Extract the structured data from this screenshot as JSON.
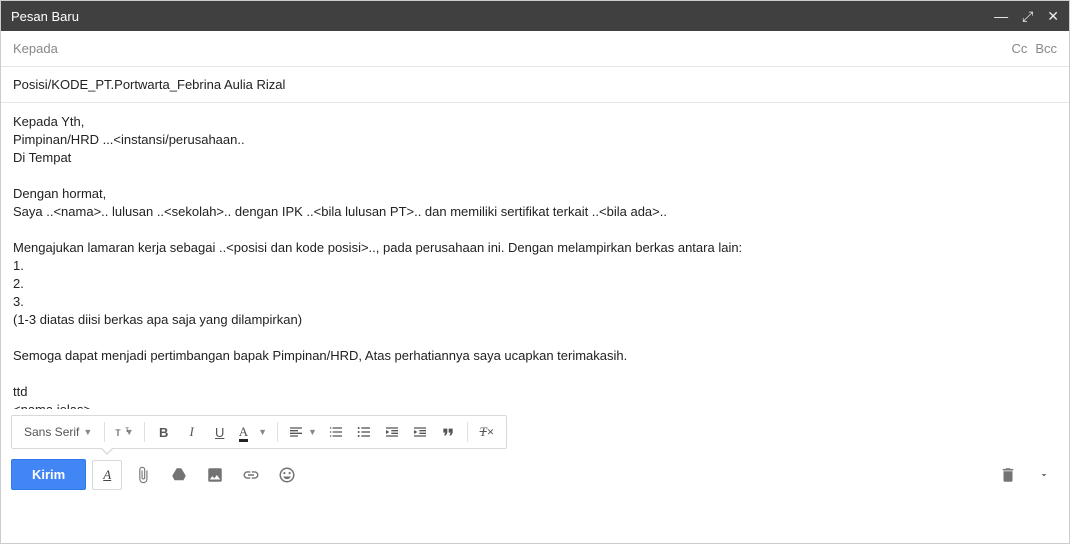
{
  "window": {
    "title": "Pesan Baru"
  },
  "to": {
    "placeholder": "Kepada",
    "cc": "Cc",
    "bcc": "Bcc"
  },
  "subject": "Posisi/KODE_PT.Portwarta_Febrina Aulia Rizal",
  "body": "Kepada Yth,\nPimpinan/HRD ...<instansi/perusahaan..\nDi Tempat\n\nDengan hormat,\nSaya ..<nama>.. lulusan ..<sekolah>.. dengan IPK ..<bila lulusan PT>.. dan memiliki sertifikat terkait ..<bila ada>..\n\nMengajukan lamaran kerja sebagai ..<posisi dan kode posisi>.., pada perusahaan ini. Dengan melampirkan berkas antara lain:\n1.\n2.\n3.\n(1-3 diatas diisi berkas apa saja yang dilampirkan)\n\nSemoga dapat menjadi pertimbangan bapak Pimpinan/HRD, Atas perhatiannya saya ucapkan terimakasih.\n\nttd\n<nama jelas>",
  "format": {
    "font_family": "Sans Serif"
  },
  "actions": {
    "send": "Kirim"
  }
}
